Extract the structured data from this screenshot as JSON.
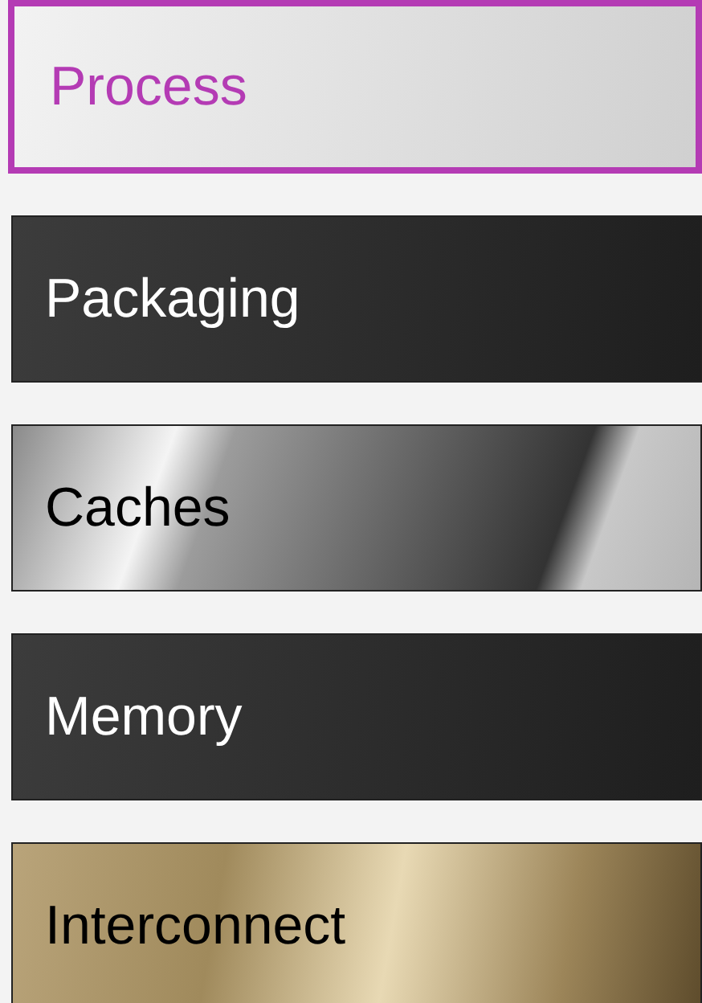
{
  "menu": [
    {
      "label": "Process",
      "selected": true,
      "kind": "light"
    },
    {
      "label": "Packaging",
      "selected": false,
      "kind": "dark"
    },
    {
      "label": "Caches",
      "selected": false,
      "kind": "silver"
    },
    {
      "label": "Memory",
      "selected": false,
      "kind": "dark"
    },
    {
      "label": "Interconnect",
      "selected": false,
      "kind": "gold"
    }
  ]
}
